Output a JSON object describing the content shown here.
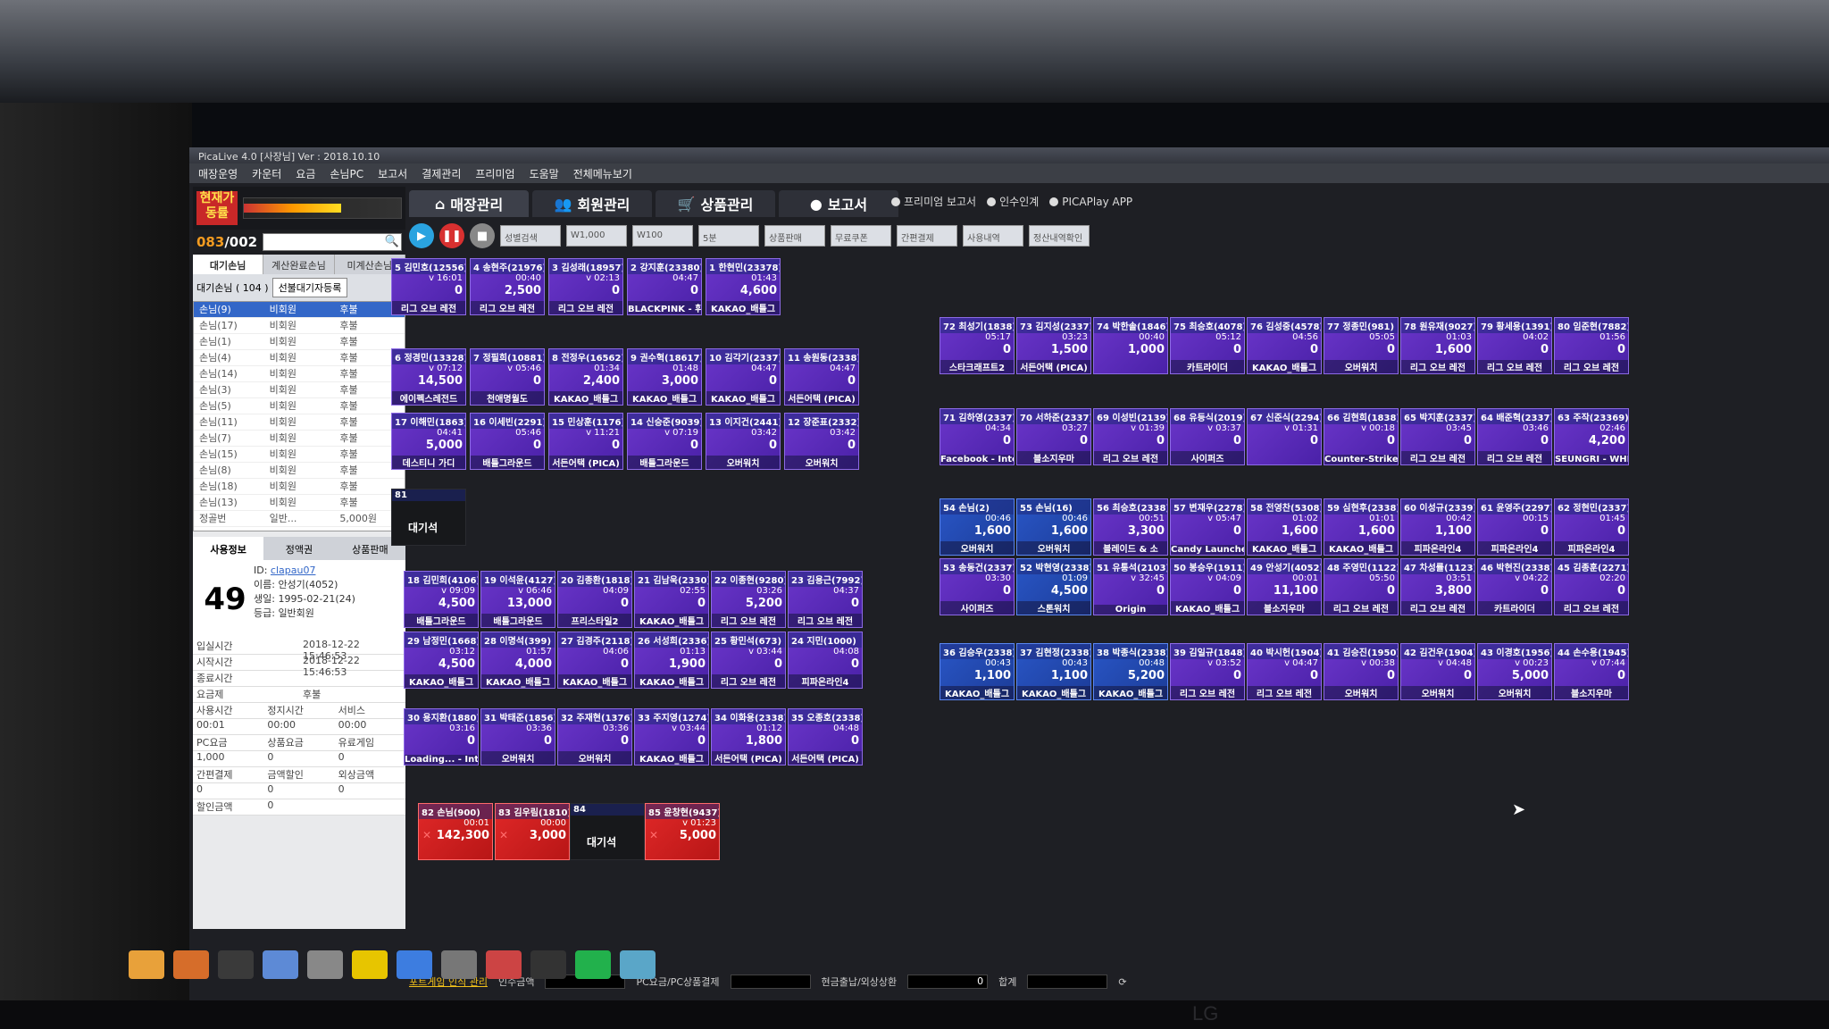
{
  "app": {
    "title": "PicaLive 4.0 [사장님] Ver : 2018.10.10",
    "menu": [
      "매장운영",
      "카운터",
      "요금",
      "손님PC",
      "보고서",
      "결제관리",
      "프리미엄",
      "도움말",
      "전체메뉴보기"
    ]
  },
  "gauge": {
    "label": "현재가동률",
    "ticks": [
      "0",
      "50",
      "100"
    ],
    "level_percent": 62
  },
  "counter": {
    "used": "083",
    "sep": "/",
    "total": "002"
  },
  "left_tabs": [
    "대기손님",
    "계산완료손님",
    "미계산손님"
  ],
  "wait_bar": {
    "label": "대기손님 ( 104 )",
    "btn": "선불대기자등록"
  },
  "guest_list": [
    [
      "손님(9)",
      "비회원",
      "후불"
    ],
    [
      "손님(17)",
      "비회원",
      "후불"
    ],
    [
      "손님(1)",
      "비회원",
      "후불"
    ],
    [
      "손님(4)",
      "비회원",
      "후불"
    ],
    [
      "손님(14)",
      "비회원",
      "후불"
    ],
    [
      "손님(3)",
      "비회원",
      "후불"
    ],
    [
      "손님(5)",
      "비회원",
      "후불"
    ],
    [
      "손님(11)",
      "비회원",
      "후불"
    ],
    [
      "손님(7)",
      "비회원",
      "후불"
    ],
    [
      "손님(15)",
      "비회원",
      "후불"
    ],
    [
      "손님(8)",
      "비회원",
      "후불"
    ],
    [
      "손님(18)",
      "비회원",
      "후불"
    ],
    [
      "손님(13)",
      "비회원",
      "후불"
    ],
    [
      "정골번",
      "일반...",
      "5,000원"
    ]
  ],
  "member_tabs": [
    "사용정보",
    "정액권",
    "상품판매"
  ],
  "member": {
    "seat": "49",
    "id_label": "ID:",
    "id": "clapau07",
    "name": "이름: 안성기(4052)",
    "birth": "생일: 1995-02-21(24)",
    "grade": "등급: 일반회원"
  },
  "usage": [
    [
      "입실시간",
      "2018-12-22 15:46:53"
    ],
    [
      "시작시간",
      "2018-12-22 15:46:53"
    ],
    [
      "종료시간",
      ""
    ],
    [
      "요금제",
      "후불"
    ],
    [
      "사용시간",
      "정지시간",
      "서비스"
    ],
    [
      "00:01",
      "00:00",
      "00:00"
    ],
    [
      "PC요금",
      "상품요금",
      "유료게임"
    ],
    [
      "1,000",
      "0",
      "0"
    ],
    [
      "간편결제",
      "금액할인",
      "외상금액"
    ],
    [
      "0",
      "0",
      "0"
    ],
    [
      "할인금액",
      "0",
      ""
    ]
  ],
  "top_tabs": [
    "매장관리",
    "회원관리",
    "상품관리",
    "보고서"
  ],
  "options": [
    "프리미엄 보고서",
    "인수인계",
    "PICAPlay APP"
  ],
  "toolbar": {
    "buttons": [
      "▶",
      "❚❚",
      "■"
    ],
    "items": [
      "성별검색",
      "W1,000",
      "W100",
      "5분",
      "상품판매",
      "무료쿠폰",
      "간편결제",
      "사용내역",
      "정산내역확인"
    ]
  },
  "seats": [
    {
      "h": "5 김민호(12556)",
      "t": "v 16:01",
      "a": "0",
      "g": "리그 오브 레전"
    },
    {
      "h": "4 송현주(21976)",
      "t": "00:40",
      "a": "2,500",
      "g": "리그 오브 레전"
    },
    {
      "h": "3 김성래(18957)",
      "t": "v 02:13",
      "a": "0",
      "g": "리그 오브 레전"
    },
    {
      "h": "2 강지훈(23380)",
      "t": "04:47",
      "a": "0",
      "g": "BLACKPINK - 휘"
    },
    {
      "h": "1 한현민(23378)",
      "t": "01:43",
      "a": "4,600",
      "g": "KAKAO_배틀그"
    },
    {
      "h": "6 정경민(13328)",
      "t": "v 07:12",
      "a": "14,500",
      "g": "에이펙스레전드"
    },
    {
      "h": "7 정필희(10881)",
      "t": "v 05:46",
      "a": "0",
      "g": "천애명월도"
    },
    {
      "h": "8 전정우(16562)",
      "t": "01:34",
      "a": "2,400",
      "g": "KAKAO_배틀그"
    },
    {
      "h": "9 권수혁(18617)",
      "t": "01:48",
      "a": "3,000",
      "g": "KAKAO_배틀그"
    },
    {
      "h": "10 김각기(2337)",
      "t": "04:47",
      "a": "0",
      "g": "KAKAO_배틀그"
    },
    {
      "h": "11 송원동(2338)",
      "t": "04:47",
      "a": "0",
      "g": "서든어택 (PICA)"
    },
    {
      "h": "17 이해민(1863)",
      "t": "04:41",
      "a": "5,000",
      "g": "데스티니 가디"
    },
    {
      "h": "16 이세빈(2291)",
      "t": "05:46",
      "a": "0",
      "g": "배틀그라운드"
    },
    {
      "h": "15 민상훈(1176)",
      "t": "v 11:21",
      "a": "0",
      "g": "서든어택 (PICA)"
    },
    {
      "h": "14 신승준(9039)",
      "t": "v 07:19",
      "a": "0",
      "g": "배틀그라운드"
    },
    {
      "h": "13 이지건(2441)",
      "t": "03:42",
      "a": "0",
      "g": "오버워치"
    },
    {
      "h": "12 장준표(2332)",
      "t": "03:42",
      "a": "0",
      "g": "오버워치"
    },
    {
      "h": "18 김민희(4106)",
      "t": "v 09:09",
      "a": "4,500",
      "g": "배틀그라운드"
    },
    {
      "h": "19 이석윤(4127)",
      "t": "v 06:46",
      "a": "13,000",
      "g": "배틀그라운드"
    },
    {
      "h": "20 김종환(1818)",
      "t": "04:09",
      "a": "0",
      "g": "프리스타일2"
    },
    {
      "h": "21 김남욱(2330)",
      "t": "02:55",
      "a": "0",
      "g": "KAKAO_배틀그"
    },
    {
      "h": "22 이종현(9280)",
      "t": "03:26",
      "a": "5,200",
      "g": "리그 오브 레전"
    },
    {
      "h": "23 김용근(7992)",
      "t": "04:37",
      "a": "0",
      "g": "리그 오브 레전"
    },
    {
      "h": "29 남정민(1668)",
      "t": "03:12",
      "a": "4,500",
      "g": "KAKAO_배틀그"
    },
    {
      "h": "28 이명석(399)",
      "t": "01:57",
      "a": "4,000",
      "g": "KAKAO_배틀그"
    },
    {
      "h": "27 김경주(2118)",
      "t": "04:06",
      "a": "0",
      "g": "KAKAO_배틀그"
    },
    {
      "h": "26 서성희(2336)",
      "t": "01:13",
      "a": "1,900",
      "g": "KAKAO_배틀그"
    },
    {
      "h": "25 황민석(673)",
      "t": "v 03:44",
      "a": "0",
      "g": "리그 오브 레전"
    },
    {
      "h": "24 지민(1000)",
      "t": "04:08",
      "a": "0",
      "g": "피파온라인4"
    },
    {
      "h": "30 용지환(1880)",
      "t": "03:16",
      "a": "0",
      "g": "Loading... - Inter"
    },
    {
      "h": "31 박태준(1856)",
      "t": "03:36",
      "a": "0",
      "g": "오버워치"
    },
    {
      "h": "32 주재현(1376)",
      "t": "03:36",
      "a": "0",
      "g": "오버워치"
    },
    {
      "h": "33 주지영(1274)",
      "t": "v 03:44",
      "a": "0",
      "g": "KAKAO_배틀그"
    },
    {
      "h": "34 이화용(2338)",
      "t": "01:12",
      "a": "1,800",
      "g": "서든어택 (PICA)"
    },
    {
      "h": "35 오종호(2338)",
      "t": "04:48",
      "a": "0",
      "g": "서든어택 (PICA)"
    },
    {
      "h": "72 최성기(1838)",
      "t": "05:17",
      "a": "0",
      "g": "스타크래프트2"
    },
    {
      "h": "73 김지성(2337)",
      "t": "03:23",
      "a": "1,500",
      "g": "서든어택 (PICA)"
    },
    {
      "h": "74 박한솔(1846)",
      "t": "00:40",
      "a": "1,000",
      "g": ""
    },
    {
      "h": "75 최승호(4078)",
      "t": "05:12",
      "a": "0",
      "g": "카트라이더"
    },
    {
      "h": "76 김성중(4578)",
      "t": "04:56",
      "a": "0",
      "g": "KAKAO_배틀그"
    },
    {
      "h": "77 정종민(981)",
      "t": "05:05",
      "a": "0",
      "g": "오버워치"
    },
    {
      "h": "78 원유재(9027)",
      "t": "01:03",
      "a": "1,600",
      "g": "리그 오브 레전"
    },
    {
      "h": "79 황세용(1391)",
      "t": "04:02",
      "a": "0",
      "g": "리그 오브 레전"
    },
    {
      "h": "80 임준현(7882)",
      "t": "01:56",
      "a": "0",
      "g": "리그 오브 레전"
    },
    {
      "h": "71 김하영(2337)",
      "t": "04:34",
      "a": "0",
      "g": "Facebook - Inter"
    },
    {
      "h": "70 서하준(2337)",
      "t": "03:27",
      "a": "0",
      "g": "블소지우마"
    },
    {
      "h": "69 이성빈(2139)",
      "t": "v 01:39",
      "a": "0",
      "g": "리그 오브 레전"
    },
    {
      "h": "68 유등식(2019)",
      "t": "v 03:37",
      "a": "0",
      "g": "사이퍼즈"
    },
    {
      "h": "67 신준식(2294)",
      "t": "v 01:31",
      "a": "0",
      "g": ""
    },
    {
      "h": "66 김현희(1838)",
      "t": "v 00:18",
      "a": "0",
      "g": "Counter-Strike"
    },
    {
      "h": "65 박지훈(2337)",
      "t": "03:45",
      "a": "0",
      "g": "리그 오브 레전"
    },
    {
      "h": "64 배준혁(2337)",
      "t": "03:46",
      "a": "0",
      "g": "리그 오브 레전"
    },
    {
      "h": "63 주작(23369)",
      "t": "02:46",
      "a": "4,200",
      "g": "SEUNGRI - WHE"
    },
    {
      "h": "54 손님(2)",
      "t": "00:46",
      "a": "1,600",
      "g": "오버워치",
      "blue": 1
    },
    {
      "h": "55 손님(16)",
      "t": "00:46",
      "a": "1,600",
      "g": "오버워치",
      "blue": 1
    },
    {
      "h": "56 최승호(2338)",
      "t": "00:51",
      "a": "3,300",
      "g": "블레이드 & 소"
    },
    {
      "h": "57 변재우(2278)",
      "t": "v 05:47",
      "a": "0",
      "g": "Candy Launcher"
    },
    {
      "h": "58 전영찬(5308)",
      "t": "01:02",
      "a": "1,600",
      "g": "KAKAO_배틀그"
    },
    {
      "h": "59 심현후(2338)",
      "t": "01:01",
      "a": "1,600",
      "g": "KAKAO_배틀그"
    },
    {
      "h": "60 이성규(2339)",
      "t": "00:42",
      "a": "1,100",
      "g": "피파온라인4"
    },
    {
      "h": "61 윤영주(2297)",
      "t": "00:15",
      "a": "0",
      "g": "피파온라인4"
    },
    {
      "h": "62 정현민(2337)",
      "t": "01:45",
      "a": "0",
      "g": "피파온라인4"
    },
    {
      "h": "53 송동건(2337)",
      "t": "03:30",
      "a": "0",
      "g": "사이퍼즈"
    },
    {
      "h": "52 박현영(2338)",
      "t": "01:09",
      "a": "4,500",
      "g": "스톤워치",
      "blue": 1
    },
    {
      "h": "51 유통석(2103)",
      "t": "v 32:45",
      "a": "0",
      "g": "Origin"
    },
    {
      "h": "50 봉승우(1911)",
      "t": "v 04:09",
      "a": "0",
      "g": "KAKAO_배틀그"
    },
    {
      "h": "49 안성기(4052)",
      "t": "00:01",
      "a": "11,100",
      "g": "블소지우마"
    },
    {
      "h": "48 주영민(1122)",
      "t": "05:50",
      "a": "0",
      "g": "리그 오브 레전"
    },
    {
      "h": "47 차성률(1123)",
      "t": "03:51",
      "a": "3,800",
      "g": "리그 오브 레전"
    },
    {
      "h": "46 박현진(2338)",
      "t": "v 04:22",
      "a": "0",
      "g": "카트라이더"
    },
    {
      "h": "45 김종훈(2271)",
      "t": "02:20",
      "a": "0",
      "g": "리그 오브 레전"
    },
    {
      "h": "36 김승우(2338)",
      "t": "00:43",
      "a": "1,100",
      "g": "KAKAO_배틀그",
      "blue": 1
    },
    {
      "h": "37 김현정(2338)",
      "t": "00:43",
      "a": "1,100",
      "g": "KAKAO_배틀그",
      "blue": 1
    },
    {
      "h": "38 박종식(2338)",
      "t": "00:48",
      "a": "5,200",
      "g": "KAKAO_배틀그",
      "blue": 1
    },
    {
      "h": "39 김일규(1848)",
      "t": "v 03:52",
      "a": "0",
      "g": "리그 오브 레전"
    },
    {
      "h": "40 박시헌(1904)",
      "t": "v 04:47",
      "a": "0",
      "g": "리그 오브 레전"
    },
    {
      "h": "41 김승진(1950)",
      "t": "v 00:38",
      "a": "0",
      "g": "오버워치"
    },
    {
      "h": "42 김건우(1904)",
      "t": "v 04:48",
      "a": "0",
      "g": "오버워치"
    },
    {
      "h": "43 이경호(1956)",
      "t": "v 00:23",
      "a": "5,000",
      "g": "오버워치"
    },
    {
      "h": "44 손수용(1945)",
      "t": "v 07:44",
      "a": "0",
      "g": "블소지우마"
    },
    {
      "h": "82 손님(900)",
      "t": "00:01",
      "a": "142,300",
      "g": "",
      "red": 1
    },
    {
      "h": "83 김우림(1810)",
      "t": "00:00",
      "a": "3,000",
      "g": "",
      "red": 1
    },
    {
      "h": "85 윤창현(9437)",
      "t": "v 01:23",
      "a": "5,000",
      "g": "",
      "red": 1
    }
  ],
  "empty_seats": [
    {
      "no": "81",
      "label": "대기석"
    },
    {
      "no": "84",
      "label": "대기석"
    }
  ],
  "status": {
    "link": "포트게임 인식 관리",
    "items": [
      "인수금액",
      "PC요금/PC상품결제",
      "현금출납/외상상환",
      "합계"
    ],
    "value": "0"
  },
  "taskbar": [
    "Chrome",
    "Media",
    "PicaLive",
    "Doc",
    "Drive",
    "Talk",
    "Store",
    "Tools",
    "Paint",
    "Pica2",
    "Green",
    "Remote"
  ],
  "monitor_brand": "LG"
}
